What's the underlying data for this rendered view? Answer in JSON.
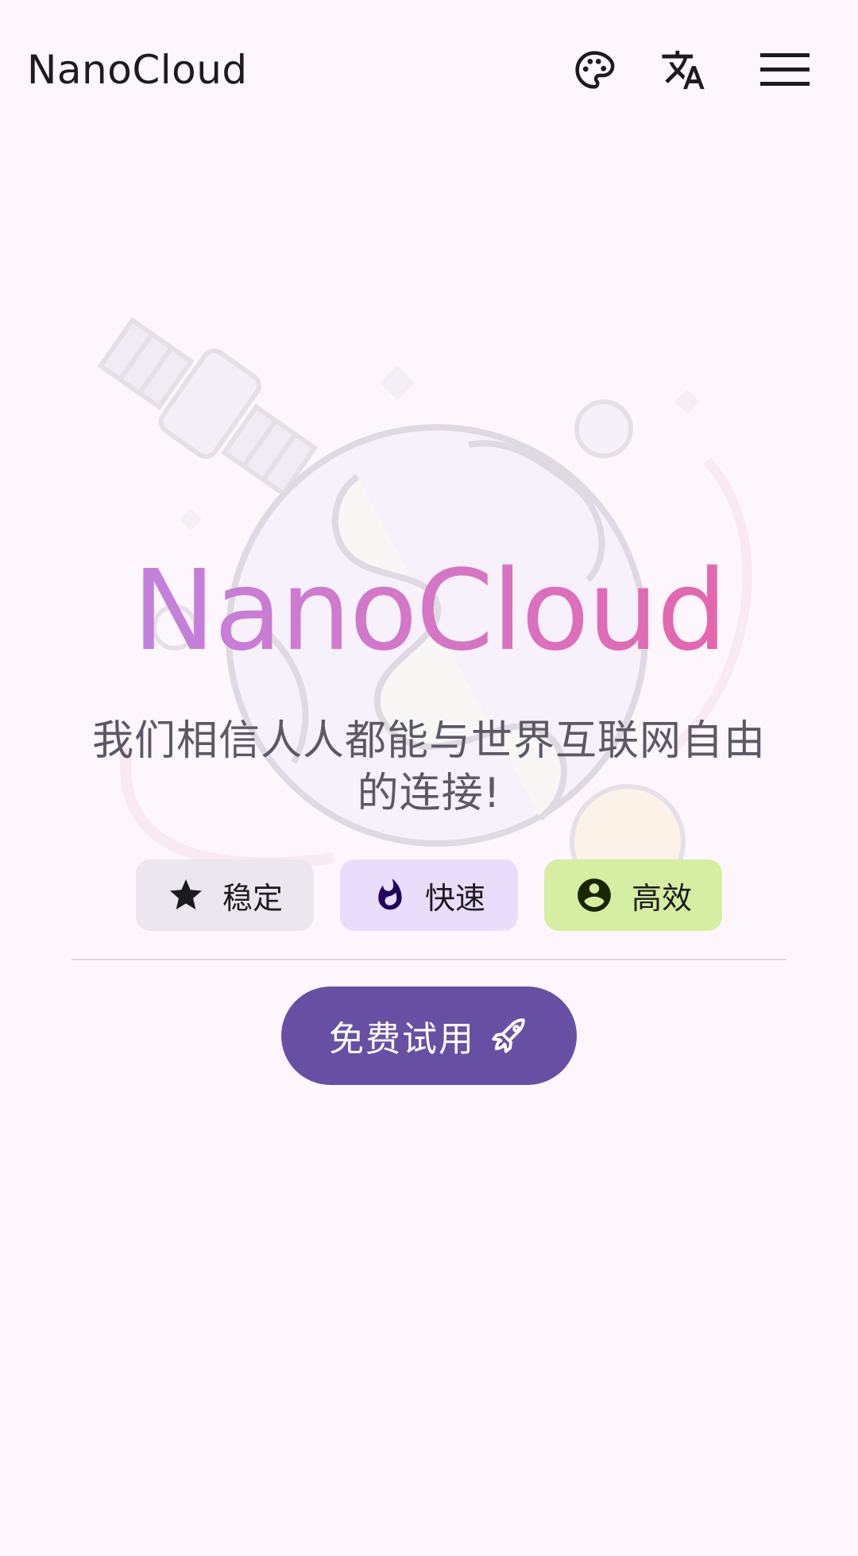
{
  "appbar": {
    "brand": "NanoCloud",
    "actions": [
      {
        "icon": "palette-icon"
      },
      {
        "icon": "translate-icon"
      },
      {
        "icon": "menu-icon"
      }
    ]
  },
  "hero": {
    "title": "NanoCloud",
    "subtitle": "我们相信人人都能与世界互联网自由的连接!",
    "illustration": "globe-satellite-illustration"
  },
  "features": [
    {
      "label": "稳定",
      "icon": "star-icon",
      "bg": "#ece6ee"
    },
    {
      "label": "快速",
      "icon": "flame-icon",
      "bg": "#eaddfc"
    },
    {
      "label": "高效",
      "icon": "account-circle-icon",
      "bg": "#d6eea1"
    }
  ],
  "cta": {
    "label": "免费试用",
    "icon": "rocket-icon",
    "color": "#6750a4"
  },
  "colors": {
    "background": "#fdf7fd",
    "gradient_start": "#b886e8",
    "gradient_end": "#ec5ea3"
  }
}
